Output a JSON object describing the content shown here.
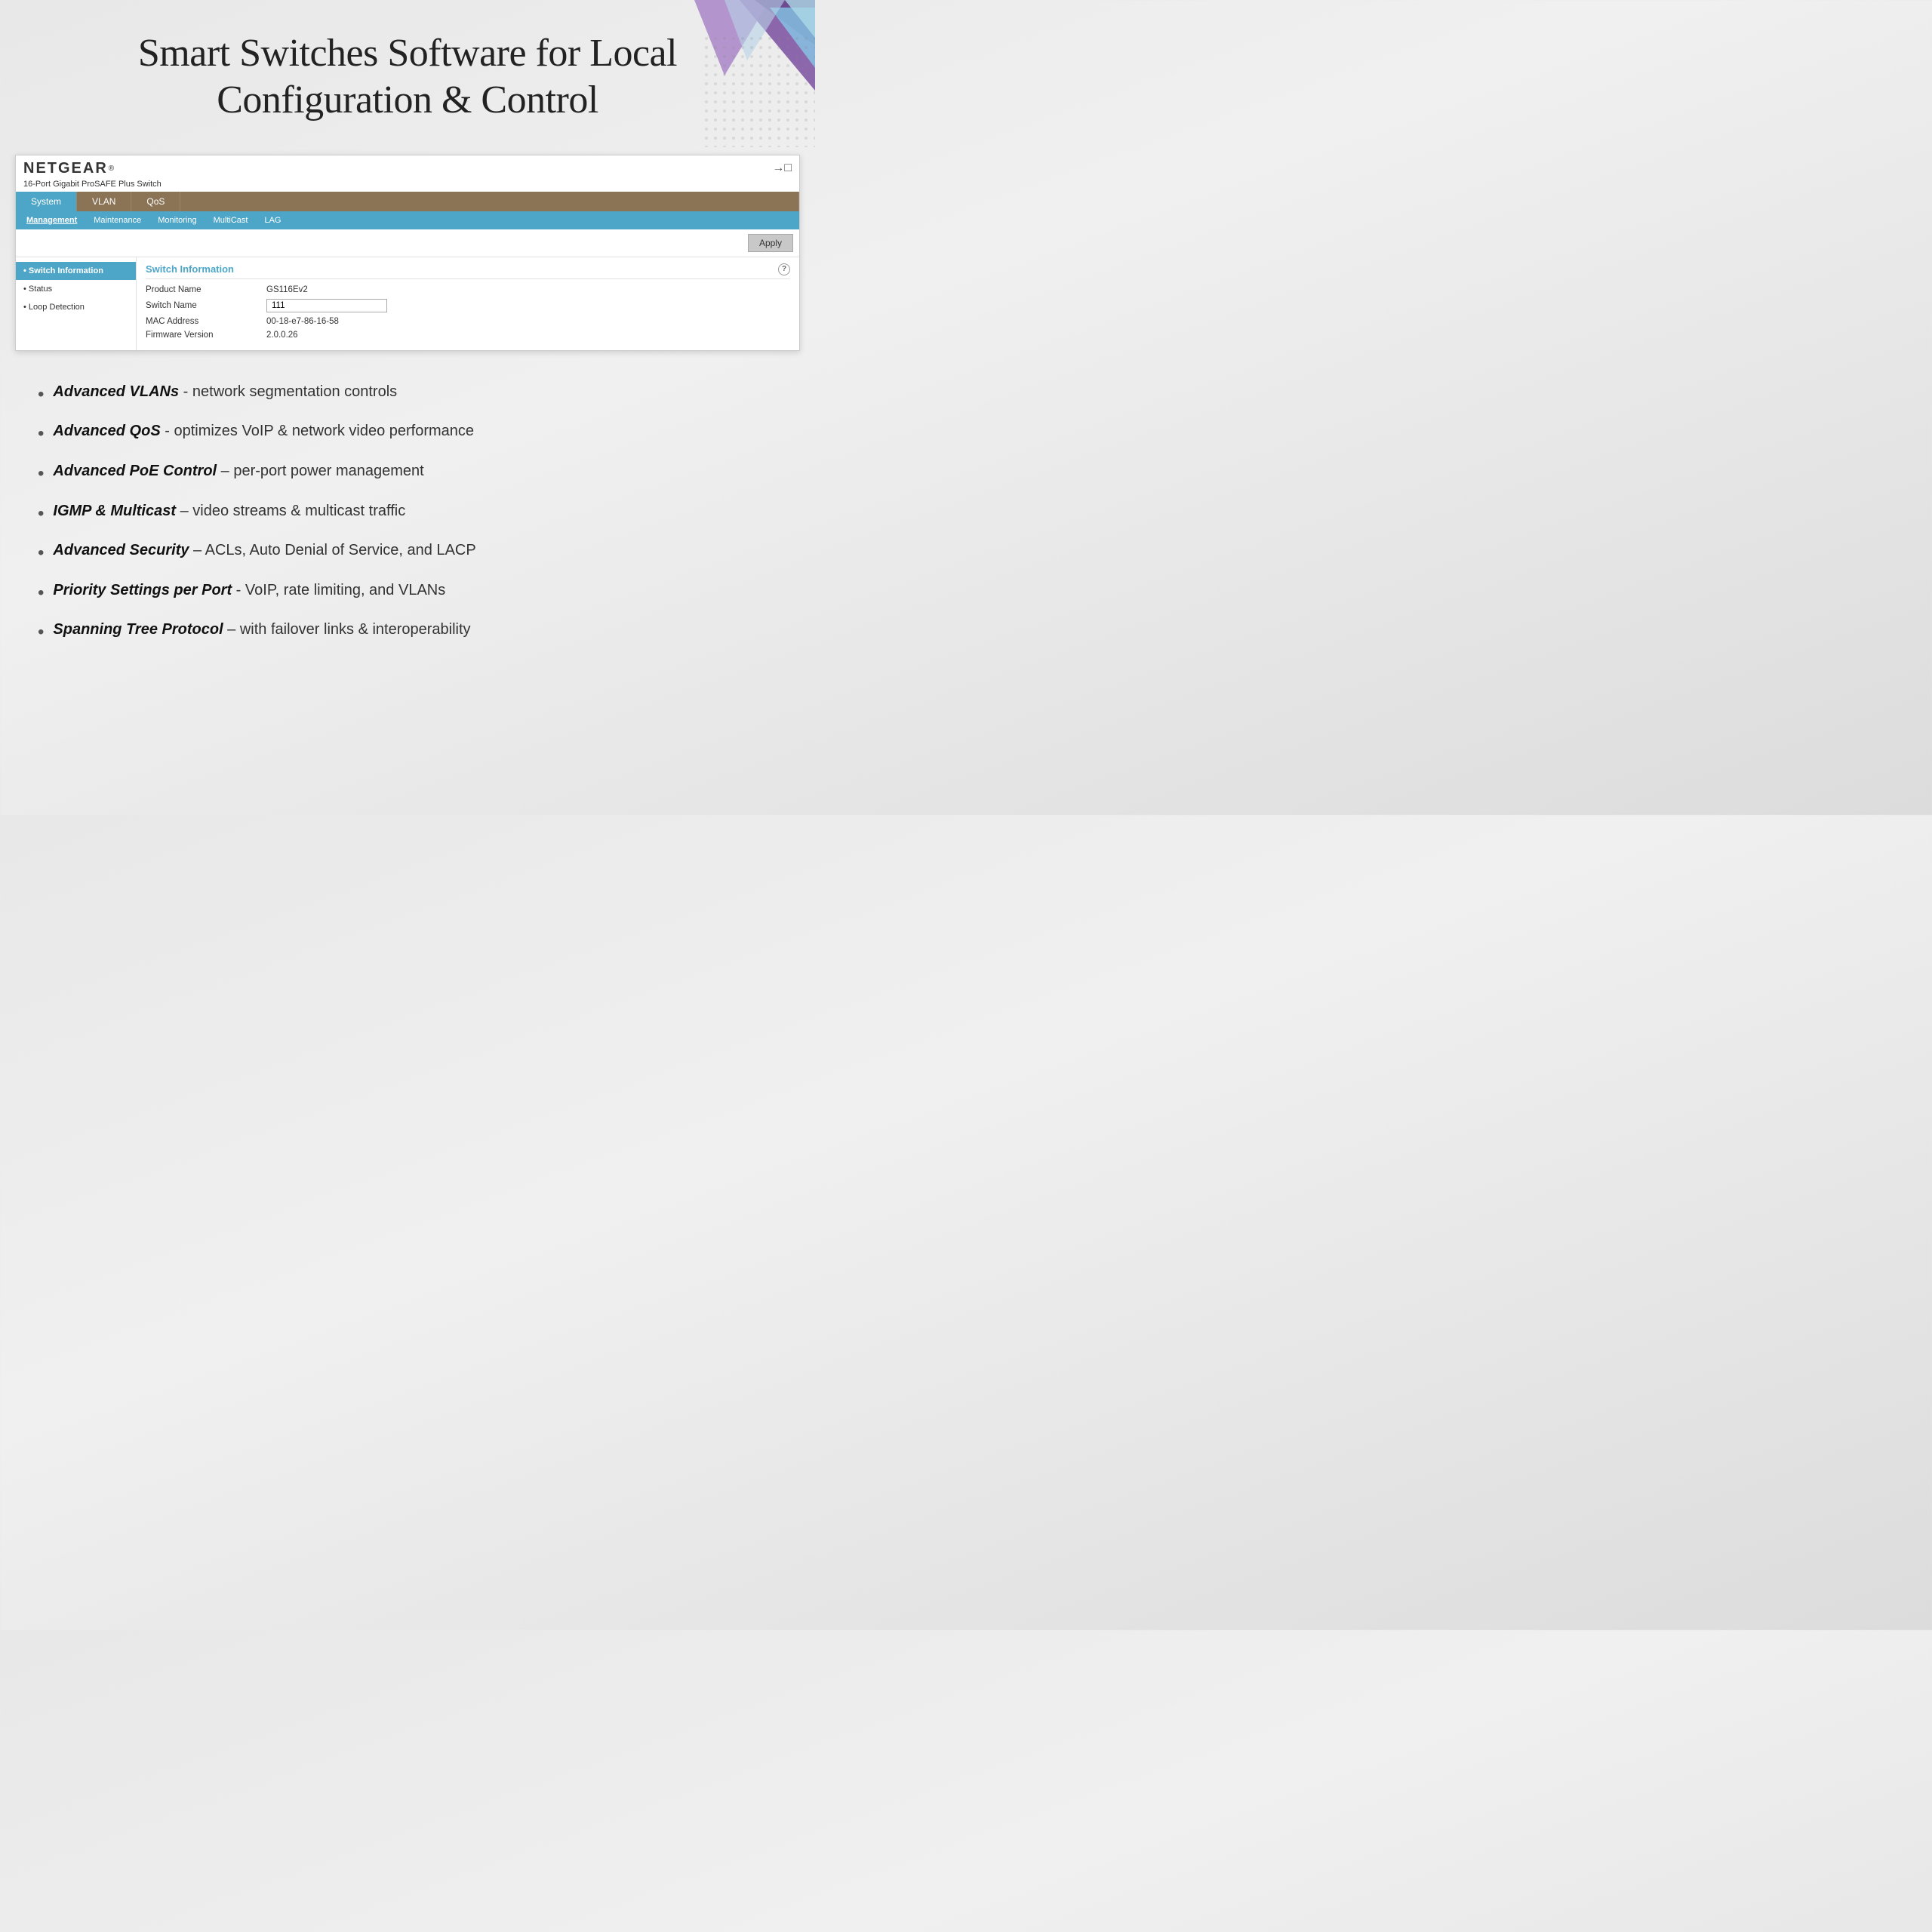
{
  "hero": {
    "title_line1": "Smart Switches Software for Local",
    "title_line2": "Configuration & Control"
  },
  "netgear": {
    "brand": "NETGEAR",
    "trademark": "®",
    "device_name": "16-Port Gigabit ProSAFE Plus Switch"
  },
  "nav": {
    "tabs": [
      {
        "label": "System",
        "active": true
      },
      {
        "label": "VLAN",
        "active": false
      },
      {
        "label": "QoS",
        "active": false
      },
      {
        "label": "",
        "active": false
      }
    ],
    "sub_items": [
      {
        "label": "Management",
        "active": true
      },
      {
        "label": "Maintenance",
        "active": false
      },
      {
        "label": "Monitoring",
        "active": false
      },
      {
        "label": "MultiCast",
        "active": false
      },
      {
        "label": "LAG",
        "active": false
      }
    ]
  },
  "toolbar": {
    "apply_label": "Apply"
  },
  "sidebar": {
    "items": [
      {
        "label": "Switch Information",
        "active": true
      },
      {
        "label": "Status",
        "active": false
      },
      {
        "label": "Loop Detection",
        "active": false
      }
    ]
  },
  "switch_info": {
    "title": "Switch Information",
    "help_icon": "?",
    "fields": [
      {
        "label": "Product Name",
        "value": "GS116Ev2",
        "editable": false
      },
      {
        "label": "Switch Name",
        "value": "111",
        "editable": true
      },
      {
        "label": "MAC Address",
        "value": "00-18-e7-86-16-58",
        "editable": false
      },
      {
        "label": "Firmware Version",
        "value": "2.0.0.26",
        "editable": false
      }
    ]
  },
  "features": [
    {
      "bold": "Advanced VLANs",
      "normal": " - network segmentation controls"
    },
    {
      "bold": "Advanced QoS",
      "normal": " - optimizes VoIP & network video performance"
    },
    {
      "bold": "Advanced PoE Control",
      "normal": " – per-port power management"
    },
    {
      "bold": "IGMP & Multicast",
      "normal": " – video streams & multicast traffic"
    },
    {
      "bold": "Advanced Security",
      "normal": " – ACLs, Auto Denial of Service, and LACP"
    },
    {
      "bold": "Priority Settings per Port",
      "normal": " - VoIP, rate limiting, and VLANs"
    },
    {
      "bold": "Spanning Tree Protocol",
      "normal": " – with failover links & interoperability"
    }
  ]
}
